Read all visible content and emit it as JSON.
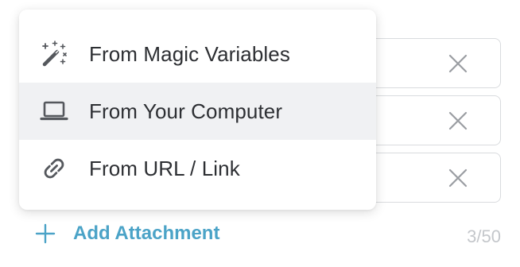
{
  "menu": {
    "items": [
      {
        "label": "From Magic Variables",
        "icon": "magic-wand-icon"
      },
      {
        "label": "From Your Computer",
        "icon": "laptop-icon"
      },
      {
        "label": "From URL / Link",
        "icon": "link-icon"
      }
    ],
    "highlighted_index": 1
  },
  "attachments": {
    "remove_icon": "close-icon",
    "count": 3
  },
  "footer": {
    "add_label": "Add Attachment",
    "add_icon": "plus-icon",
    "counter": "3/50"
  },
  "colors": {
    "accent": "#4ba3c7",
    "highlight": "#f0f1f3",
    "text": "#2d2f33",
    "muted": "#c4c7cb"
  }
}
